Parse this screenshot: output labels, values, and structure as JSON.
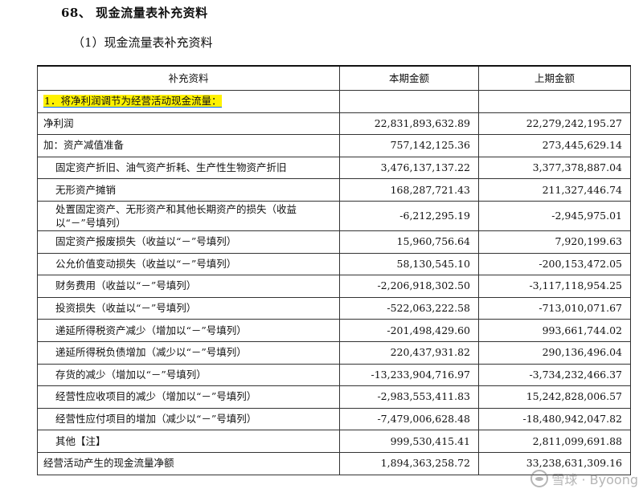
{
  "heading": "68、 现金流量表补充资料",
  "subheading": "（1）现金流量表补充资料",
  "table": {
    "headers": [
      "补充资料",
      "本期金额",
      "上期金额"
    ],
    "section_label": "1．将净利润调节为经营活动现金流量：",
    "rows": [
      {
        "label": "净利润",
        "current": "22,831,893,632.89",
        "prior": "22,279,242,195.27",
        "indent": false
      },
      {
        "label": "加：资产减值准备",
        "current": "757,142,125.36",
        "prior": "273,445,629.14",
        "indent": false
      },
      {
        "label": "固定资产折旧、油气资产折耗、生产性生物资产折旧",
        "current": "3,476,137,137.22",
        "prior": "3,377,378,887.04",
        "indent": true
      },
      {
        "label": "无形资产摊销",
        "current": "168,287,721.43",
        "prior": "211,327,446.74",
        "indent": true
      },
      {
        "label": "处置固定资产、无形资产和其他长期资产的损失（收益以“－”号填列）",
        "current": "-6,212,295.19",
        "prior": "-2,945,975.01",
        "indent": true
      },
      {
        "label": "固定资产报废损失（收益以“－”号填列）",
        "current": "15,960,756.64",
        "prior": "7,920,199.63",
        "indent": true
      },
      {
        "label": "公允价值变动损失（收益以“－”号填列）",
        "current": "58,130,545.10",
        "prior": "-200,153,472.05",
        "indent": true
      },
      {
        "label": "财务费用（收益以“－”号填列）",
        "current": "-2,206,918,302.50",
        "prior": "-3,117,118,954.25",
        "indent": true
      },
      {
        "label": "投资损失（收益以“－”号填列）",
        "current": "-522,063,222.58",
        "prior": "-713,010,071.67",
        "indent": true
      },
      {
        "label": "递延所得税资产减少（增加以“－”号填列）",
        "current": "-201,498,429.60",
        "prior": "993,661,744.02",
        "indent": true
      },
      {
        "label": "递延所得税负债增加（减少以“－”号填列）",
        "current": "220,437,931.82",
        "prior": "290,136,496.04",
        "indent": true
      },
      {
        "label": "存货的减少（增加以“－”号填列）",
        "current": "-13,233,904,716.97",
        "prior": "-3,734,232,466.37",
        "indent": true
      },
      {
        "label": "经营性应收项目的减少（增加以“－”号填列）",
        "current": "-2,983,553,411.83",
        "prior": "15,242,828,006.57",
        "indent": true
      },
      {
        "label": "经营性应付项目的增加（减少以“－”号填列）",
        "current": "-7,479,006,628.48",
        "prior": "-18,480,942,047.82",
        "indent": true
      },
      {
        "label": "其他【注】",
        "current": "999,530,415.41",
        "prior": "2,811,099,691.88",
        "indent": true
      },
      {
        "label": "经营活动产生的现金流量净额",
        "current": "1,894,363,258.72",
        "prior": "33,238,631,309.16",
        "indent": false
      }
    ]
  },
  "watermark": "雪球 · Byoong",
  "colors": {
    "highlight": "#fff200",
    "underline": "#0b6cff"
  }
}
